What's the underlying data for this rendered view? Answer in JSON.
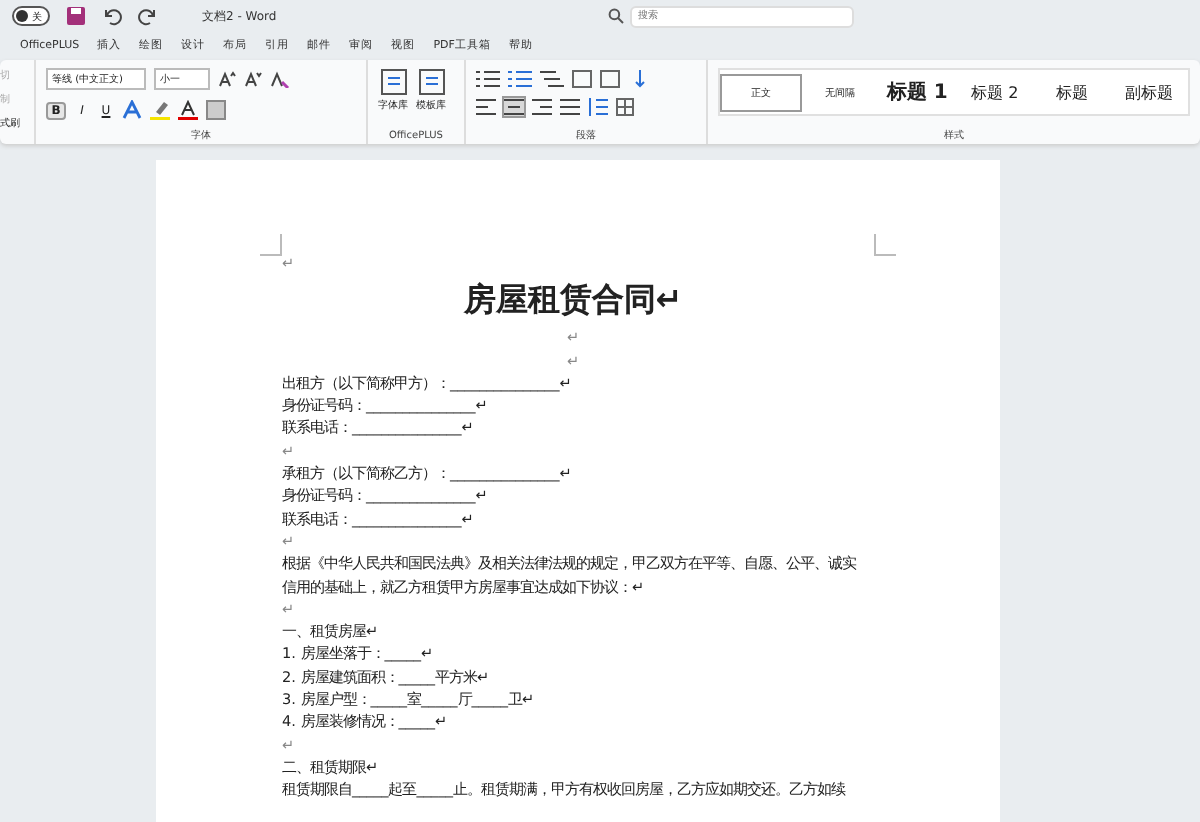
{
  "title_bar": {
    "autosave_on": false,
    "autosave_label": "关",
    "document_title": "文档2 - Word",
    "search": {
      "placeholder": "搜索"
    }
  },
  "menu_tabs": [
    {
      "label": "OfficePLUS",
      "selected": false
    },
    {
      "label": "插入",
      "selected": false
    },
    {
      "label": "绘图",
      "selected": false
    },
    {
      "label": "设计",
      "selected": false
    },
    {
      "label": "布局",
      "selected": false
    },
    {
      "label": "引用",
      "selected": false
    },
    {
      "label": "邮件",
      "selected": false
    },
    {
      "label": "审阅",
      "selected": false
    },
    {
      "label": "视图",
      "selected": false
    },
    {
      "label": "PDF工具箱",
      "selected": false
    },
    {
      "label": "帮助",
      "selected": false
    }
  ],
  "ribbon": {
    "clipboard": [
      {
        "label": "切",
        "disabled": true
      },
      {
        "label": "制",
        "disabled": true
      },
      {
        "label": "式刷",
        "disabled": false
      }
    ],
    "font": {
      "font_name": "等线 (中文正文)",
      "font_size": "小一",
      "format_buttons": [
        "B",
        "I",
        "U"
      ],
      "group_label": "字体"
    },
    "officeplus": {
      "buttons": [
        "字体库",
        "模板库"
      ],
      "group_label": "OfficePLUS"
    },
    "paragraph": {
      "group_label": "段落"
    },
    "styles": {
      "items": [
        {
          "label": "正文",
          "kind": "normal",
          "selected": true
        },
        {
          "label": "无间隔",
          "kind": "normal",
          "selected": false
        },
        {
          "label": "标题 1",
          "kind": "heading1",
          "selected": false
        },
        {
          "label": "标题 2",
          "kind": "heading2",
          "selected": false
        },
        {
          "label": "标题",
          "kind": "heading2",
          "selected": false
        },
        {
          "label": "副标题",
          "kind": "heading2",
          "selected": false
        }
      ],
      "group_label": "样式"
    }
  },
  "document": {
    "paragraphs": [
      {
        "kind": "empty",
        "text": "↵"
      },
      {
        "kind": "title",
        "text": "房屋租赁合同↵"
      },
      {
        "kind": "center",
        "text": "↵"
      },
      {
        "kind": "center",
        "text": "↵"
      },
      {
        "kind": "text",
        "text": "出租方（以下简称甲方）：_______________↵"
      },
      {
        "kind": "text",
        "text": "身份证号码：_______________↵"
      },
      {
        "kind": "text",
        "text": "联系电话：_______________↵"
      },
      {
        "kind": "empty",
        "text": "↵"
      },
      {
        "kind": "text",
        "text": "承租方（以下简称乙方）：_______________↵"
      },
      {
        "kind": "text",
        "text": "身份证号码：_______________↵"
      },
      {
        "kind": "text",
        "text": "联系电话：_______________↵"
      },
      {
        "kind": "empty",
        "text": "↵"
      },
      {
        "kind": "text",
        "text": "根据《中华人民共和国民法典》及相关法律法规的规定，甲乙双方在平等、自愿、公平、诚实信用的基础上，就乙方租赁甲方房屋事宜达成如下协议：↵"
      },
      {
        "kind": "empty",
        "text": "↵"
      },
      {
        "kind": "text",
        "text": "一、租赁房屋↵"
      },
      {
        "kind": "text",
        "text": "1. 房屋坐落于：_____↵"
      },
      {
        "kind": "text",
        "text": "2. 房屋建筑面积：_____平方米↵"
      },
      {
        "kind": "text",
        "text": "3. 房屋户型：_____室_____厅_____卫↵"
      },
      {
        "kind": "text",
        "text": "4. 房屋装修情况：_____↵"
      },
      {
        "kind": "empty",
        "text": "↵"
      },
      {
        "kind": "text",
        "text": "二、租赁期限↵"
      },
      {
        "kind": "text",
        "text": "租赁期限自_____起至_____止。租赁期满，甲方有权收回房屋，乙方应如期交还。乙方如续"
      }
    ]
  }
}
